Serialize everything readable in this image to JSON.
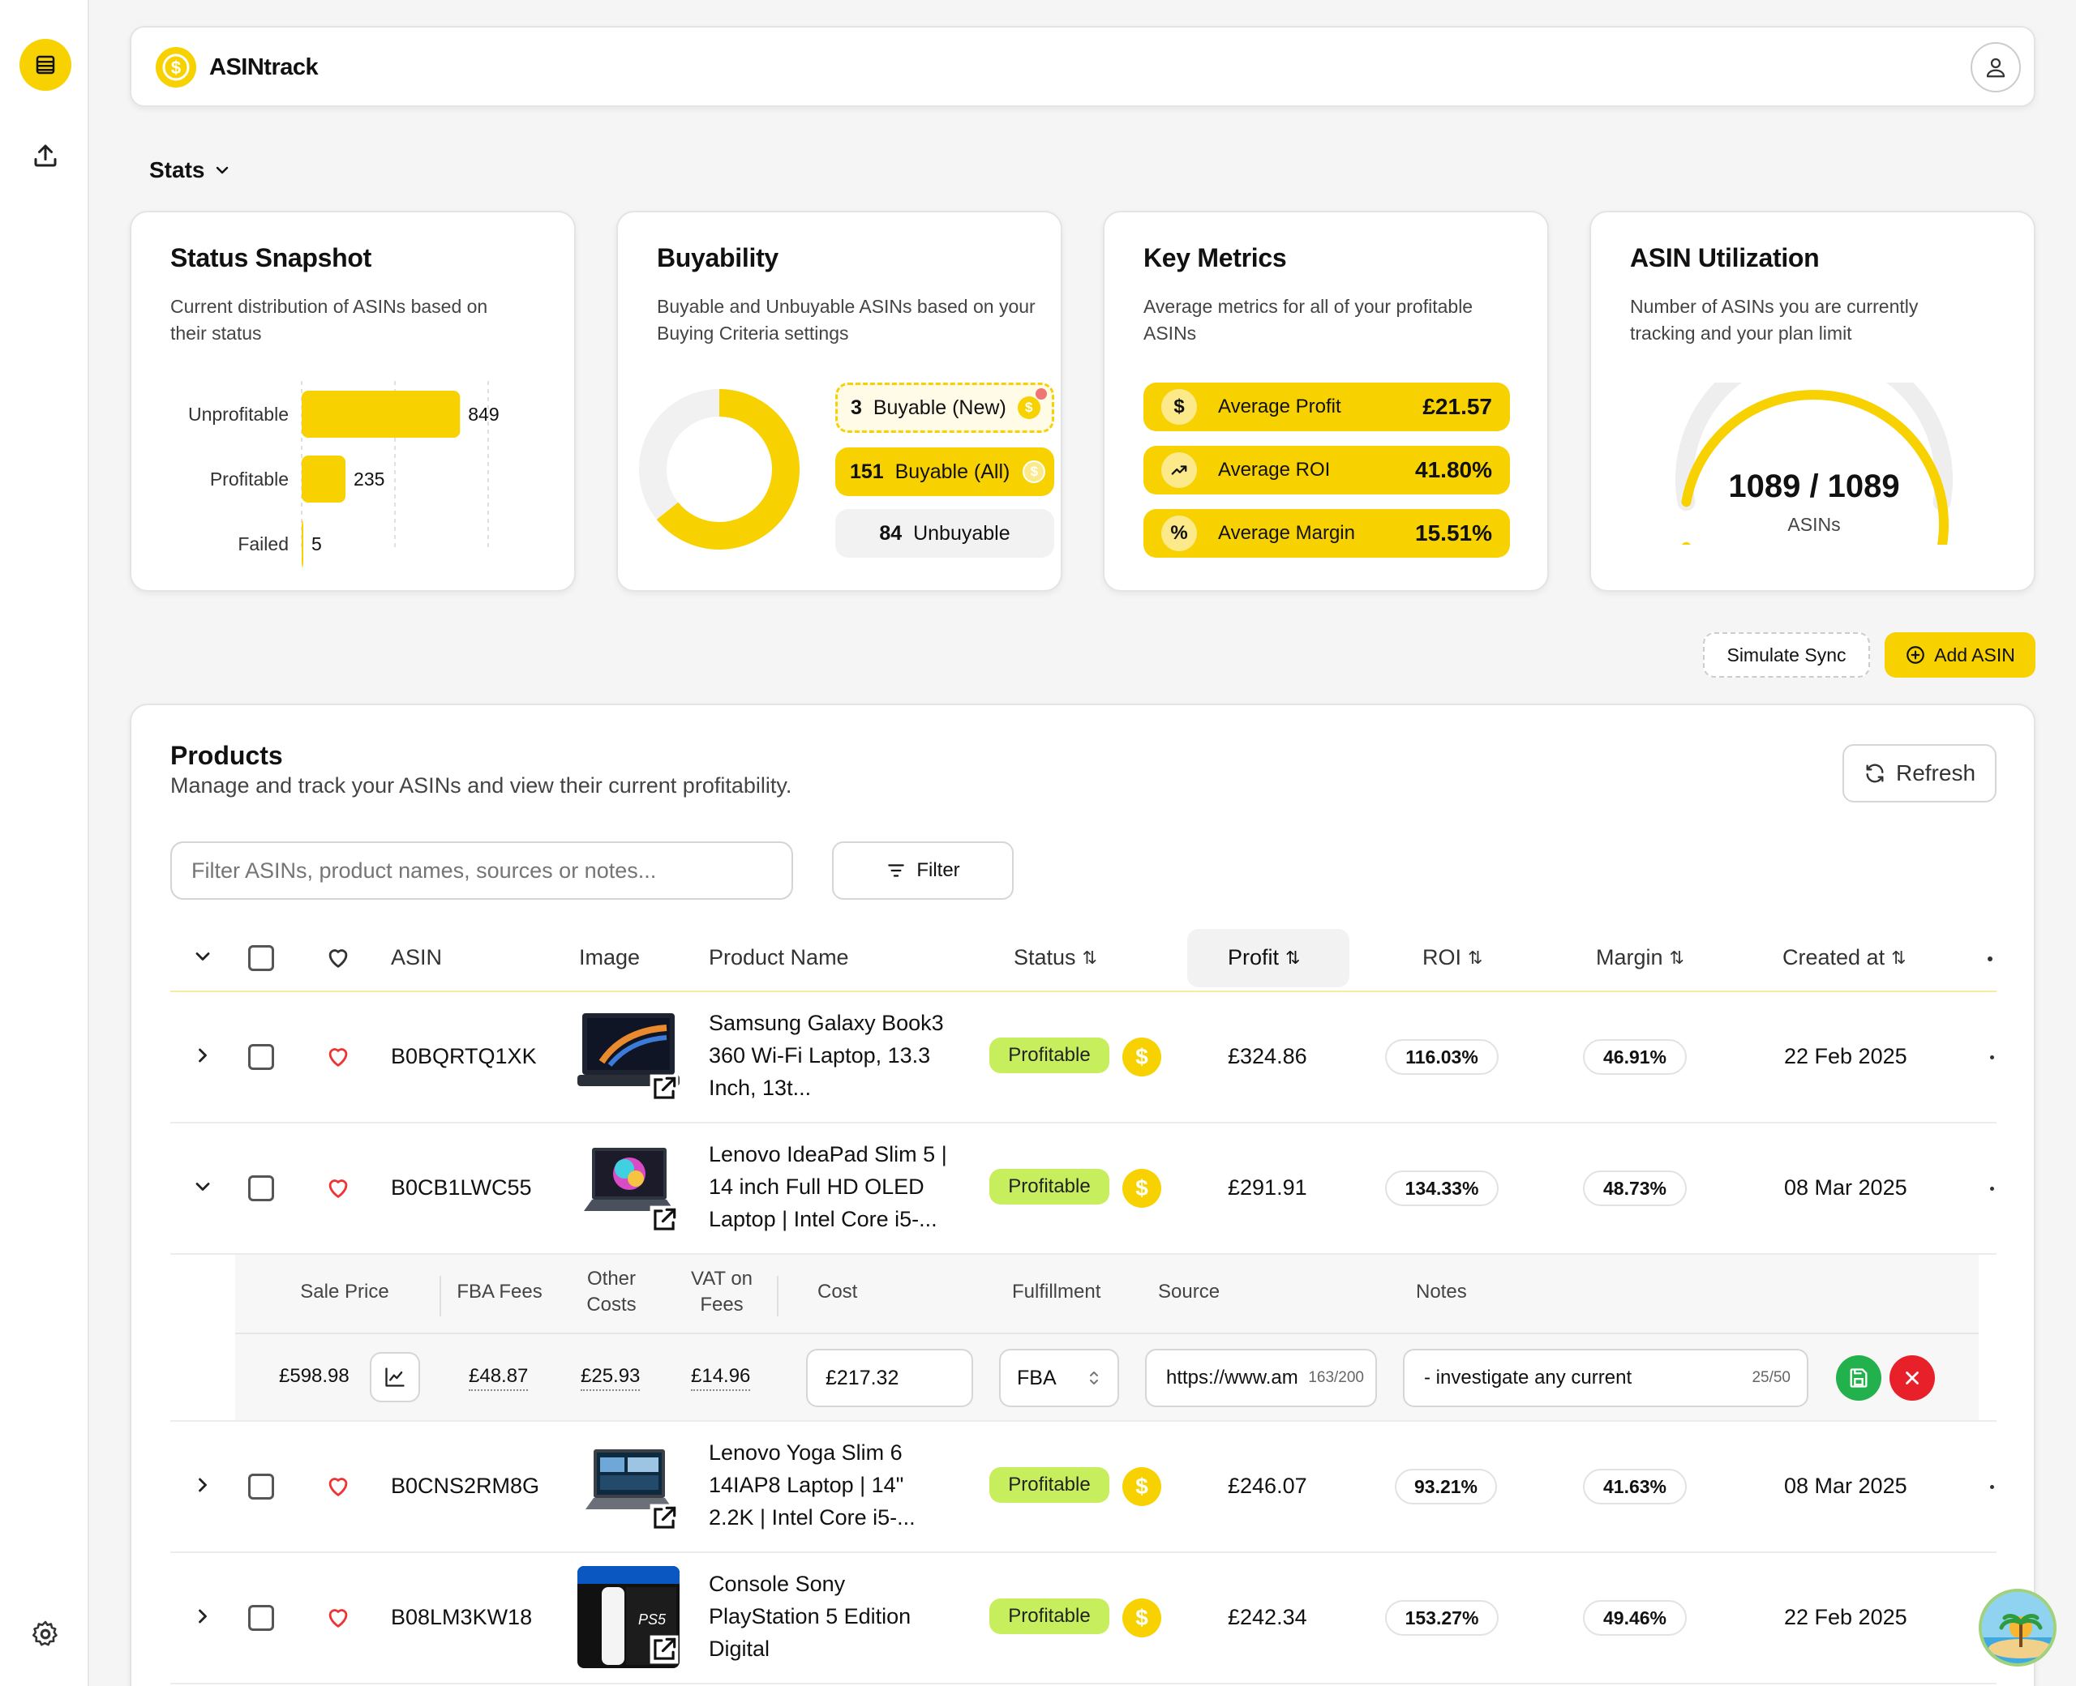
{
  "app": {
    "name": "ASINtrack"
  },
  "colors": {
    "accent": "#f7d200",
    "profitable": "#c7ef5d",
    "save": "#22b14c",
    "cancel": "#e8202a"
  },
  "stats": {
    "toggle_label": "Stats",
    "status_snapshot": {
      "title": "Status Snapshot",
      "description": "Current distribution of ASINs based on their status",
      "chart_data": {
        "type": "bar",
        "orientation": "horizontal",
        "categories": [
          "Unprofitable",
          "Profitable",
          "Failed"
        ],
        "values": [
          849,
          235,
          5
        ]
      }
    },
    "buyability": {
      "title": "Buyability",
      "description": "Buyable and Unbuyable ASINs based on your Buying Criteria settings",
      "chart_data": {
        "type": "pie",
        "categories": [
          "Buyable (All)",
          "Unbuyable"
        ],
        "values": [
          151,
          84
        ]
      },
      "items": [
        {
          "count": "3",
          "label": "Buyable (New)"
        },
        {
          "count": "151",
          "label": "Buyable (All)"
        },
        {
          "count": "84",
          "label": "Unbuyable"
        }
      ]
    },
    "key_metrics": {
      "title": "Key Metrics",
      "description": "Average metrics for all of your profitable ASINs",
      "items": [
        {
          "icon": "dollar-icon",
          "label": "Average Profit",
          "value": "£21.57"
        },
        {
          "icon": "trend-up-icon",
          "label": "Average ROI",
          "value": "41.80%"
        },
        {
          "icon": "percent-icon",
          "label": "Average Margin",
          "value": "15.51%"
        }
      ]
    },
    "utilization": {
      "title": "ASIN Utilization",
      "description": "Number of ASINs you are currently tracking and your plan limit",
      "value": "1089 / 1089",
      "unit": "ASINs",
      "fraction": 1.0
    }
  },
  "actions": {
    "simulate_sync": "Simulate Sync",
    "add_asin": "Add ASIN"
  },
  "products": {
    "title": "Products",
    "description": "Manage and track your ASINs and view their current profitability.",
    "refresh_label": "Refresh",
    "search_placeholder": "Filter ASINs, product names, sources or notes...",
    "filter_label": "Filter",
    "columns": {
      "asin": "ASIN",
      "image": "Image",
      "name": "Product Name",
      "status": "Status",
      "profit": "Profit",
      "roi": "ROI",
      "margin": "Margin",
      "created": "Created at"
    },
    "rows": [
      {
        "asin": "B0BQRTQ1XK",
        "name": "Samsung Galaxy Book3 360 Wi-Fi Laptop, 13.3 Inch, 13t...",
        "status": "Profitable",
        "profit": "£324.86",
        "roi": "116.03%",
        "margin": "46.91%",
        "created": "22 Feb 2025"
      },
      {
        "asin": "B0CB1LWC55",
        "name": "Lenovo IdeaPad Slim 5 | 14 inch Full HD OLED Laptop | Intel Core i5-...",
        "status": "Profitable",
        "profit": "£291.91",
        "roi": "134.33%",
        "margin": "48.73%",
        "created": "08 Mar 2025"
      },
      {
        "asin": "B0CNS2RM8G",
        "name": "Lenovo Yoga Slim 6 14IAP8 Laptop | 14\" 2.2K | Intel Core i5-...",
        "status": "Profitable",
        "profit": "£246.07",
        "roi": "93.21%",
        "margin": "41.63%",
        "created": "08 Mar 2025"
      },
      {
        "asin": "B08LM3KW18",
        "name": "Console Sony PlayStation 5 Edition Digital",
        "status": "Profitable",
        "profit": "£242.34",
        "roi": "153.27%",
        "margin": "49.46%",
        "created": "22 Feb 2025"
      }
    ],
    "expanded": {
      "headers": {
        "sale_price": "Sale Price",
        "fba_fees": "FBA Fees",
        "other_costs": "Other Costs",
        "vat_on_fees": "VAT on Fees",
        "cost": "Cost",
        "fulfillment": "Fulfillment",
        "source": "Source",
        "notes": "Notes"
      },
      "sale_price": "£598.98",
      "fba_fees": "£48.87",
      "other_costs": "£25.93",
      "vat_on_fees": "£14.96",
      "cost": "£217.32",
      "fulfillment": "FBA",
      "source": "https://www.am",
      "source_count": "163/200",
      "notes": "- investigate any current",
      "notes_count": "25/50"
    }
  }
}
